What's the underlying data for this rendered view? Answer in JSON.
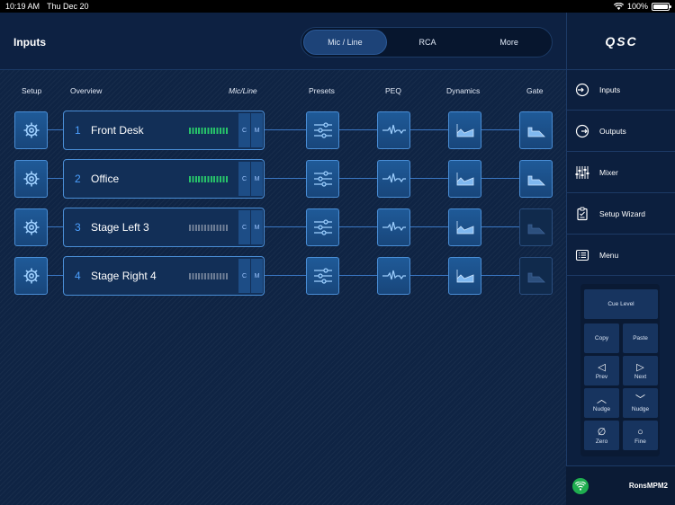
{
  "status": {
    "time": "10:19 AM",
    "date": "Thu Dec 20",
    "battery": "100%"
  },
  "header": {
    "title": "Inputs",
    "tabs": [
      {
        "label": "Mic / Line",
        "active": true
      },
      {
        "label": "RCA",
        "active": false
      },
      {
        "label": "More",
        "active": false
      }
    ]
  },
  "columns": {
    "setup": "Setup",
    "overview": "Overview",
    "mode": "Mic/Line",
    "presets": "Presets",
    "peq": "PEQ",
    "dynamics": "Dynamics",
    "gate": "Gate"
  },
  "channels": [
    {
      "number": "1",
      "name": "Front Desk",
      "cue": "C",
      "mute": "M",
      "signal": "active",
      "gate_on": true
    },
    {
      "number": "2",
      "name": "Office",
      "cue": "C",
      "mute": "M",
      "signal": "active",
      "gate_on": true
    },
    {
      "number": "3",
      "name": "Stage Left 3",
      "cue": "C",
      "mute": "M",
      "signal": "idle",
      "gate_on": false
    },
    {
      "number": "4",
      "name": "Stage Right 4",
      "cue": "C",
      "mute": "M",
      "signal": "idle",
      "gate_on": false
    }
  ],
  "sidebar": {
    "logo": "QSC",
    "items": [
      {
        "label": "Inputs",
        "icon": "input-icon"
      },
      {
        "label": "Outputs",
        "icon": "output-icon"
      },
      {
        "label": "Mixer",
        "icon": "mixer-icon"
      },
      {
        "label": "Setup Wizard",
        "icon": "clipboard-icon"
      },
      {
        "label": "Menu",
        "icon": "menu-icon"
      }
    ]
  },
  "pad": {
    "cue_level": "Cue Level",
    "copy": "Copy",
    "paste": "Paste",
    "prev": "Prev",
    "next": "Next",
    "nudge_up": "Nudge",
    "nudge_down": "Nudge",
    "zero": "Zero",
    "fine": "Fine"
  },
  "device": {
    "name": "RonsMPM2"
  },
  "colors": {
    "accent": "#4ca0ff",
    "meter_active": "#27c36a",
    "tile": "#1f5a98",
    "background": "#0f2444"
  }
}
